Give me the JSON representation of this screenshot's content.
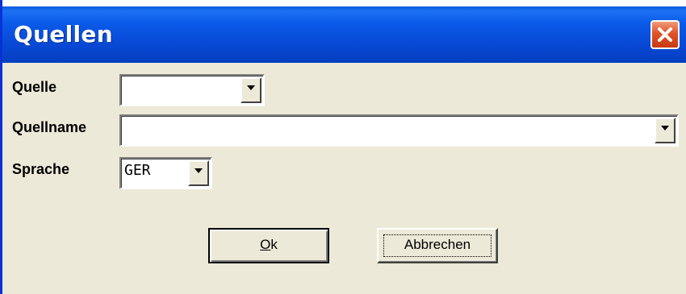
{
  "window": {
    "title": "Quellen",
    "close_icon": "close-icon"
  },
  "form": {
    "quelle": {
      "label": "Quelle",
      "value": ""
    },
    "quellname": {
      "label": "Quellname",
      "value": ""
    },
    "sprache": {
      "label": "Sprache",
      "value": "GER"
    }
  },
  "buttons": {
    "ok_mnemonic": "O",
    "ok_rest": "k",
    "cancel_label": "Abbrechen"
  },
  "colors": {
    "titlebar": "#0a5ae8",
    "close_button": "#e0542a",
    "dialog_background": "#ece9d8"
  }
}
